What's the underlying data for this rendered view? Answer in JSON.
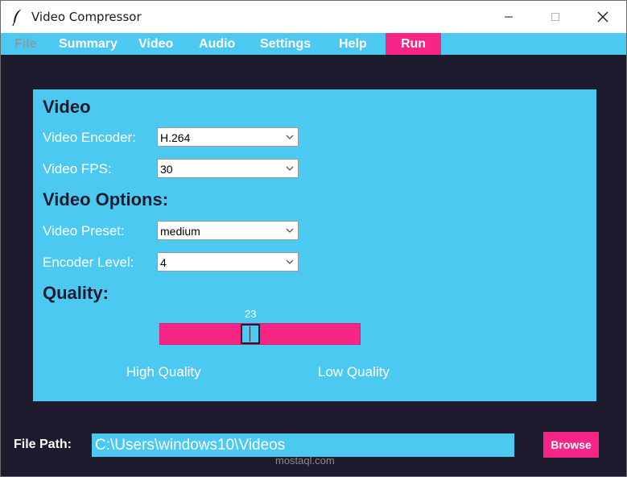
{
  "window": {
    "title": "Video Compressor"
  },
  "menu": {
    "items": [
      {
        "label": "File",
        "enabled": false
      },
      {
        "label": "Summary",
        "enabled": true
      },
      {
        "label": "Video",
        "enabled": true
      },
      {
        "label": "Audio",
        "enabled": true
      },
      {
        "label": "Settings",
        "enabled": true
      },
      {
        "label": "Help",
        "enabled": true
      }
    ],
    "run_label": "Run"
  },
  "video": {
    "section_title": "Video",
    "encoder_label": "Video Encoder:",
    "encoder_value": "H.264",
    "fps_label": "Video FPS:",
    "fps_value": "30"
  },
  "options": {
    "section_title": "Video Options:",
    "preset_label": "Video Preset:",
    "preset_value": "medium",
    "level_label": "Encoder Level:",
    "level_value": "4"
  },
  "quality": {
    "section_title": "Quality:",
    "value": "23",
    "high_label": "High Quality",
    "low_label": "Low Quality"
  },
  "file": {
    "label": "File Path:",
    "value": "C:\\Users\\windows10\\Videos",
    "browse_label": "Browse"
  },
  "watermark": "mostaql.com",
  "colors": {
    "background": "#1f1b2e",
    "accent_blue": "#4cc9f0",
    "accent_pink": "#f72585"
  }
}
